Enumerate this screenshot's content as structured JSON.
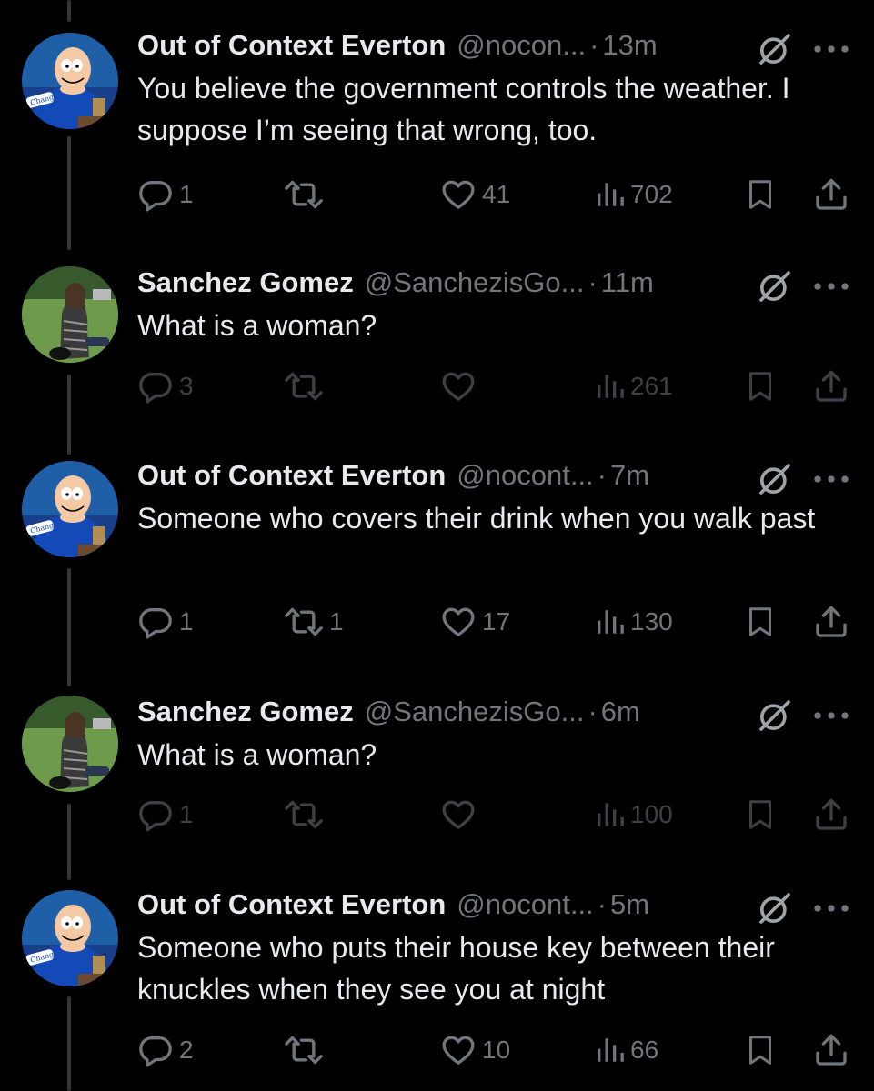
{
  "colors": {
    "background": "#000000",
    "text": "#e7e9ea",
    "secondary": "#71767b",
    "thread_line": "#333639"
  },
  "tweets": [
    {
      "name": "Out of Context Everton",
      "handle": "@nocon...",
      "time": "13m",
      "text": "You believe the government controls the weather. I suppose I’m seeing that wrong, too.",
      "replies": "1",
      "reposts": "",
      "likes": "41",
      "views": "702",
      "avatar": "peter-griffin-everton-avatar"
    },
    {
      "name": "Sanchez Gomez",
      "handle": "@SanchezisGo...",
      "time": "11m",
      "text": "What is a woman?",
      "replies": "3",
      "reposts": "",
      "likes": "",
      "views": "261",
      "avatar": "man-on-grass-avatar"
    },
    {
      "name": "Out of Context Everton",
      "handle": "@nocont...",
      "time": "7m",
      "text": "Someone who covers their drink when you walk past",
      "replies": "1",
      "reposts": "1",
      "likes": "17",
      "views": "130",
      "avatar": "peter-griffin-everton-avatar"
    },
    {
      "name": "Sanchez Gomez",
      "handle": "@SanchezisGo...",
      "time": "6m",
      "text": "What is a woman?",
      "replies": "1",
      "reposts": "",
      "likes": "",
      "views": "100",
      "avatar": "man-on-grass-avatar"
    },
    {
      "name": "Out of Context Everton",
      "handle": "@nocont...",
      "time": "5m",
      "text": "Someone who puts their house key between their knuckles when they see you at night",
      "replies": "2",
      "reposts": "",
      "likes": "10",
      "views": "66",
      "avatar": "peter-griffin-everton-avatar"
    }
  ]
}
